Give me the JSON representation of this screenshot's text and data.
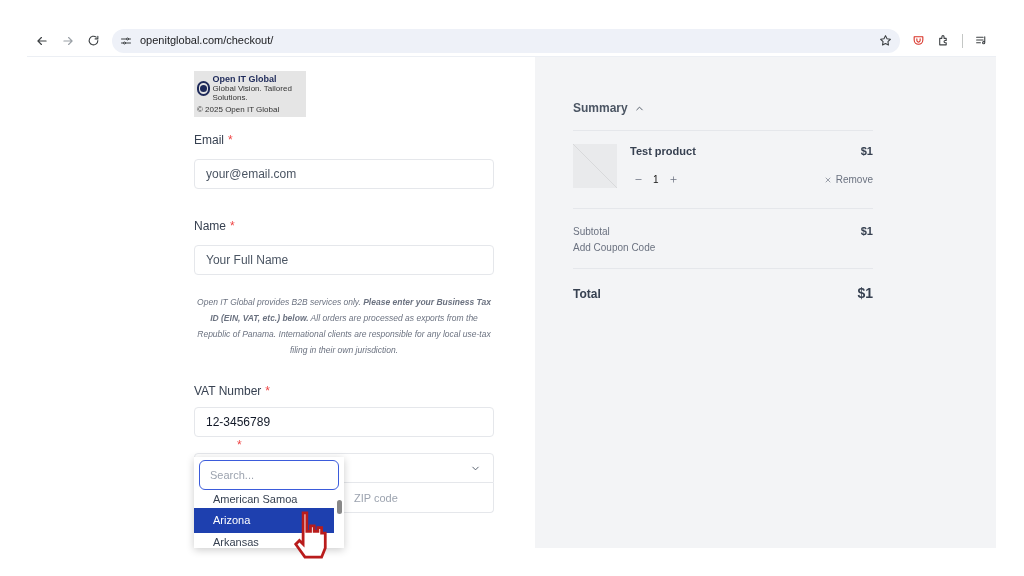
{
  "browser": {
    "url": "openitglobal.com/checkout/"
  },
  "logo": {
    "name": "Open IT Global",
    "tagline": "Global Vision. Tailored Solutions.",
    "copyright": "© 2025 Open IT Global"
  },
  "form": {
    "required_mark": "*",
    "fields": [
      {
        "label": "Email",
        "required": true,
        "placeholder": "your@email.com"
      },
      {
        "label": "Name",
        "required": true,
        "placeholder": "Your Full Name"
      }
    ],
    "notice": "Open IT Global provides B2B services only. **Please enter your Business Tax ID (EIN, VAT, etc.) below.** All orders are processed as exports from the Republic of Panama. International clients are responsible for any local use-tax filing in their own jurisdiction.",
    "vat": {
      "label": "VAT Number",
      "required": true,
      "value": "12-3456789"
    },
    "address": {
      "required": true,
      "zip_placeholder": "ZIP code"
    }
  },
  "dropdown": {
    "search_placeholder": "Search...",
    "options": [
      {
        "label": "American Samoa",
        "selected": false
      },
      {
        "label": "Arizona",
        "selected": true
      },
      {
        "label": "Arkansas",
        "selected": false
      }
    ]
  },
  "summary": {
    "title": "Summary",
    "expanded": true,
    "items": [
      {
        "name": "Test product",
        "price": "$1",
        "quantity": "1",
        "remove": "Remove"
      }
    ],
    "subtotal_label": "Subtotal",
    "subtotal": "$1",
    "coupon": "Add Coupon Code",
    "total_label": "Total",
    "total": "$1"
  }
}
